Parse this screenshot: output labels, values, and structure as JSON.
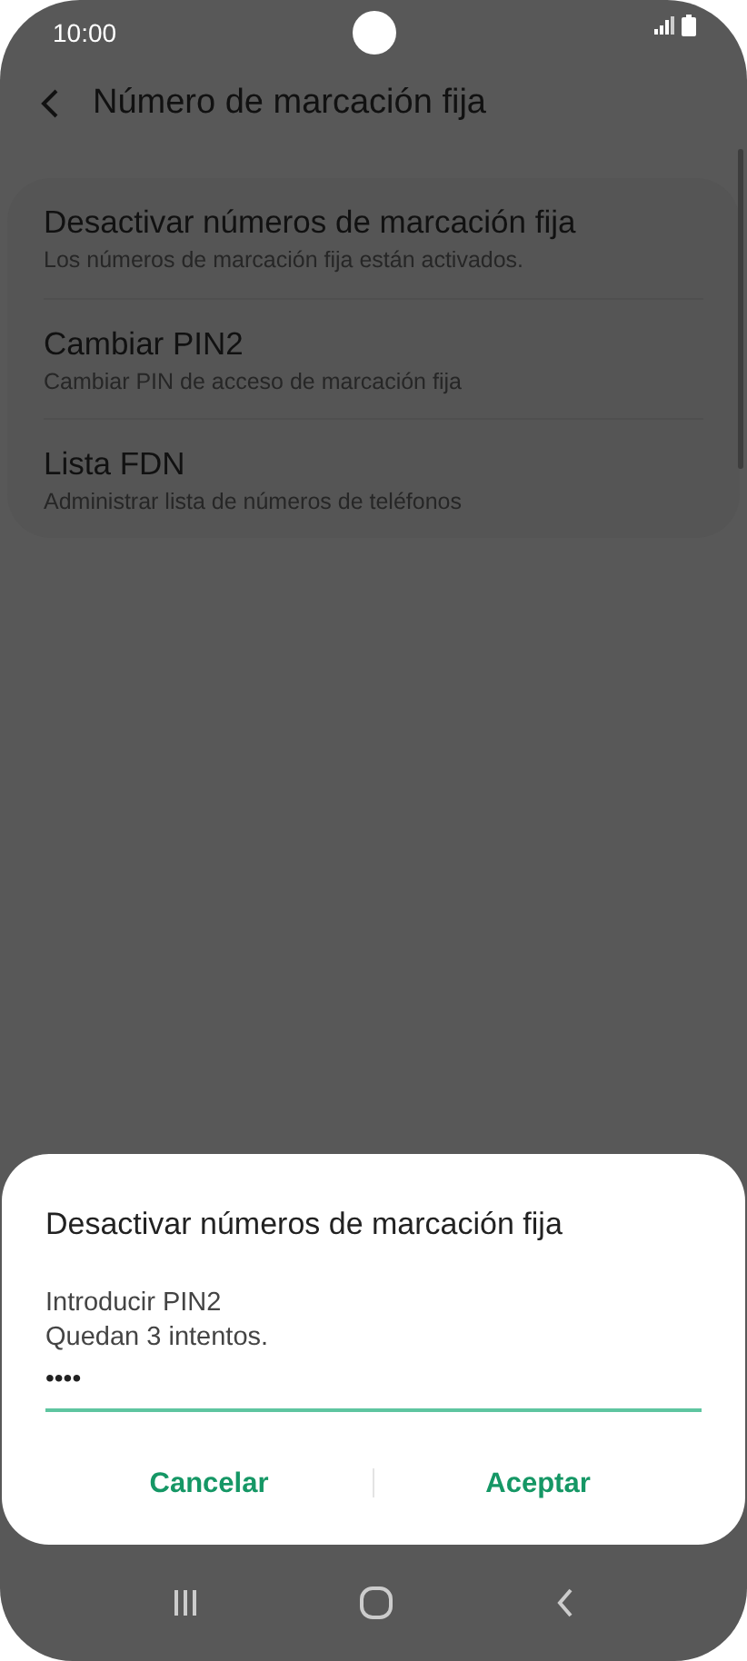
{
  "status_bar": {
    "time": "10:00"
  },
  "header": {
    "title": "Número de marcación fija"
  },
  "settings": [
    {
      "title": "Desactivar números de marcación fija",
      "subtitle": "Los números de marcación fija están activados."
    },
    {
      "title": "Cambiar PIN2",
      "subtitle": "Cambiar PIN de acceso de marcación fija"
    },
    {
      "title": "Lista FDN",
      "subtitle": "Administrar lista de números de teléfonos"
    }
  ],
  "dialog": {
    "title": "Desactivar números de marcación fija",
    "prompt": "Introducir PIN2",
    "attempts": "Quedan 3 intentos.",
    "pin_value": "••••",
    "buttons": [
      "Cancelar",
      "Aceptar"
    ]
  }
}
